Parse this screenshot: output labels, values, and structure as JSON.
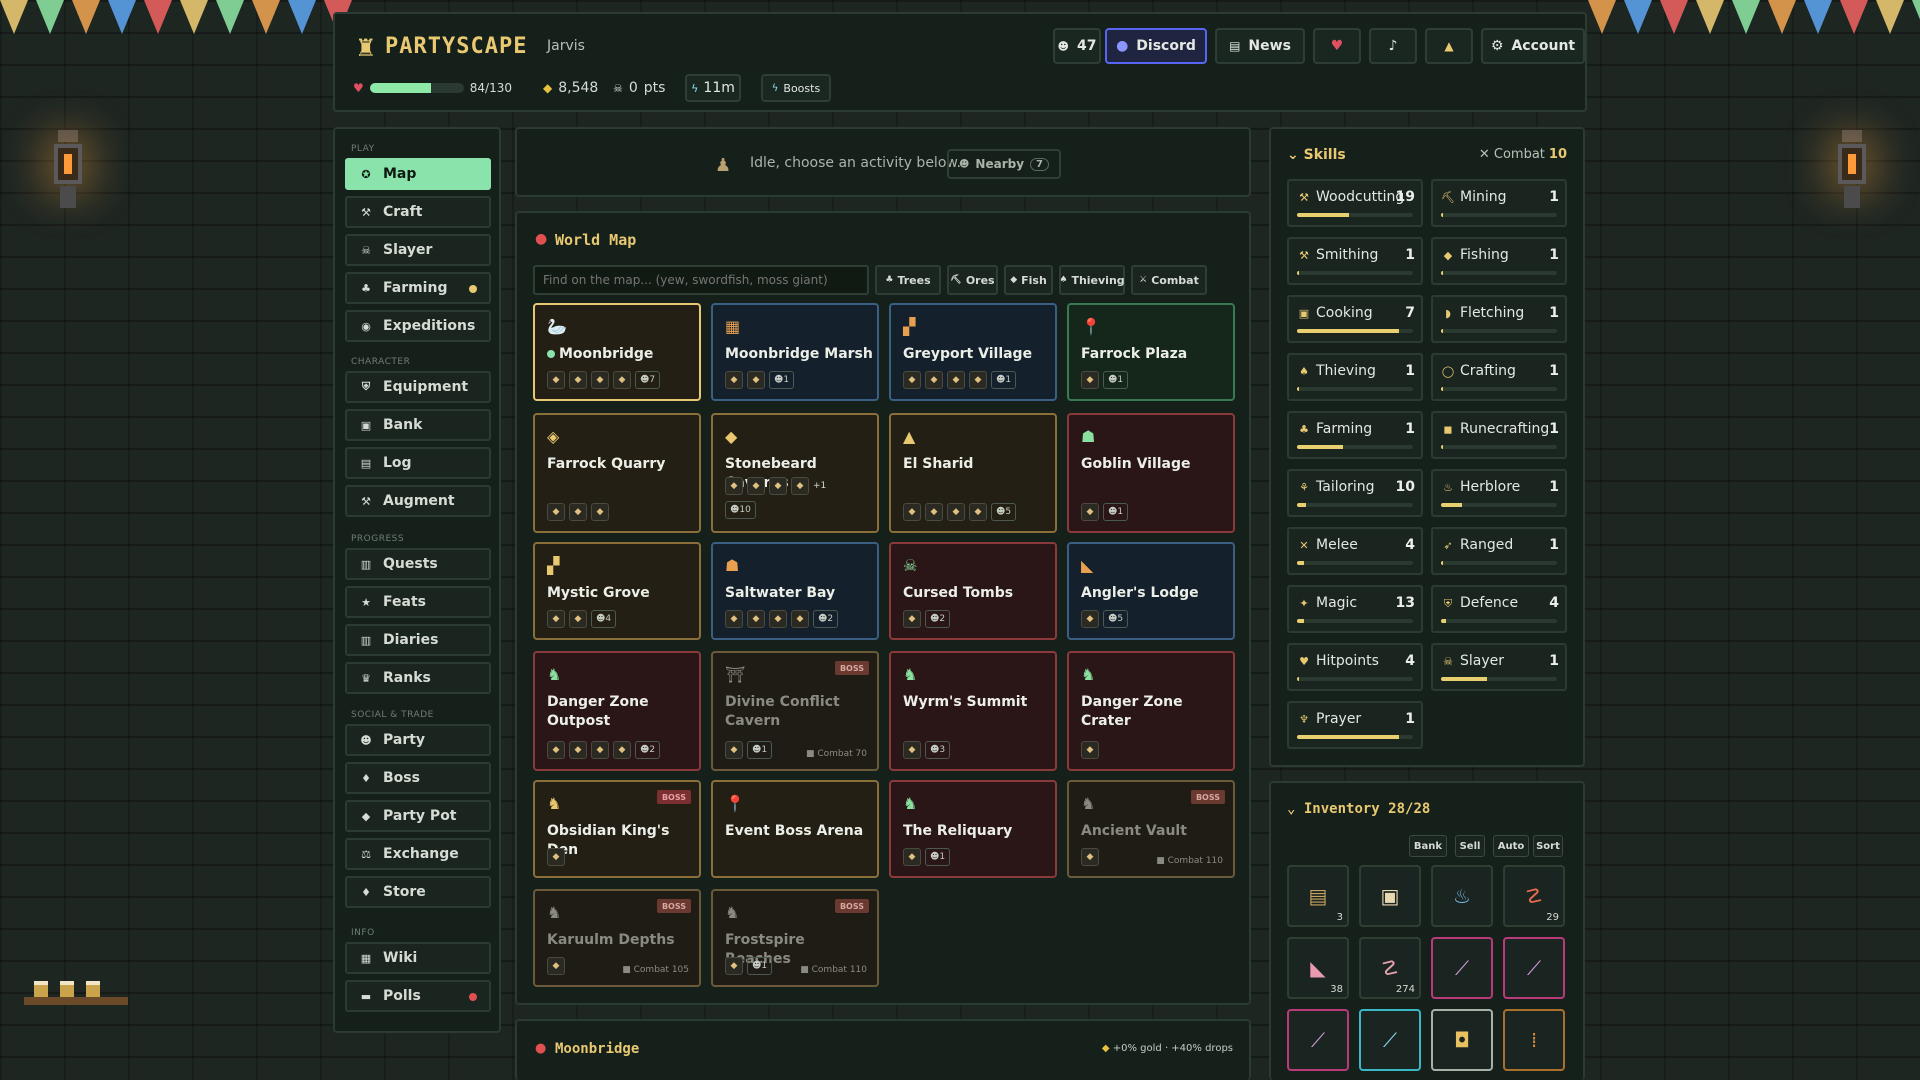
{
  "header": {
    "logo": "PARTYSCAPE",
    "username": "Jarvis",
    "online_count": "47",
    "buttons": {
      "discord": "Discord",
      "news": "News",
      "account": "Account"
    },
    "hp": {
      "value": 84,
      "max": 130,
      "text": "84/130"
    },
    "gold": "8,548",
    "points": "0",
    "points_label": "pts",
    "timer": "11m",
    "boosts": "Boosts"
  },
  "nav": {
    "sections": [
      "PLAY",
      "CHARACTER",
      "PROGRESS",
      "SOCIAL & TRADE",
      "INFO"
    ],
    "items": [
      {
        "label": "Map",
        "icon": "compass-icon",
        "glyph": "✪"
      },
      {
        "label": "Craft",
        "icon": "hammer-icon",
        "glyph": "⚒"
      },
      {
        "label": "Slayer",
        "icon": "skull-icon",
        "glyph": "☠"
      },
      {
        "label": "Farming",
        "icon": "sprout-icon",
        "glyph": "♣"
      },
      {
        "label": "Expeditions",
        "icon": "globe-icon",
        "glyph": "◉"
      },
      {
        "label": "Equipment",
        "icon": "shield-icon",
        "glyph": "⛨"
      },
      {
        "label": "Bank",
        "icon": "chest-icon",
        "glyph": "▣"
      },
      {
        "label": "Log",
        "icon": "book-icon",
        "glyph": "▤"
      },
      {
        "label": "Augment",
        "icon": "upgrade-icon",
        "glyph": "⚒"
      },
      {
        "label": "Quests",
        "icon": "scroll-icon",
        "glyph": "▥"
      },
      {
        "label": "Feats",
        "icon": "star-icon",
        "glyph": "★"
      },
      {
        "label": "Diaries",
        "icon": "diary-icon",
        "glyph": "▥"
      },
      {
        "label": "Ranks",
        "icon": "trophy-icon",
        "glyph": "♛"
      },
      {
        "label": "Party",
        "icon": "users-icon",
        "glyph": "☻"
      },
      {
        "label": "Boss",
        "icon": "boss-icon",
        "glyph": "♦"
      },
      {
        "label": "Party Pot",
        "icon": "pot-icon",
        "glyph": "◆"
      },
      {
        "label": "Exchange",
        "icon": "scales-icon",
        "glyph": "⚖"
      },
      {
        "label": "Store",
        "icon": "gem-icon",
        "glyph": "♦"
      },
      {
        "label": "Wiki",
        "icon": "wiki-book-icon",
        "glyph": "▦"
      },
      {
        "label": "Polls",
        "icon": "chat-icon",
        "glyph": "▬"
      }
    ]
  },
  "status": {
    "text": "Idle, choose an activity below.",
    "nearby_label": "Nearby",
    "nearby_count": "7"
  },
  "map": {
    "title": "World Map",
    "search_placeholder": "Find on the map... (yew, swordfish, moss giant)",
    "filters": [
      "Trees",
      "Ores",
      "Fish",
      "Thieving",
      "Combat"
    ],
    "boss_badge": "BOSS",
    "locations": [
      {
        "name": "Moonbridge",
        "color": "yellow",
        "icon": "🦢",
        "tags": 4,
        "players": "7",
        "selected": true
      },
      {
        "name": "Moonbridge Marsh",
        "color": "blue",
        "icon": "▦",
        "tags": 2,
        "players": "1"
      },
      {
        "name": "Greyport Village",
        "color": "blue",
        "icon": "▞",
        "tags": 4,
        "players": "1"
      },
      {
        "name": "Farrock Plaza",
        "color": "green",
        "icon": "📍",
        "tags": 1,
        "players": "1"
      },
      {
        "name": "Farrock Quarry",
        "color": "yellow",
        "icon": "◈",
        "tags": 3,
        "players": ""
      },
      {
        "name": "Stonebeard Caverns",
        "color": "yellow",
        "icon": "◆",
        "tags": 4,
        "extra": "+1",
        "players": "10"
      },
      {
        "name": "El Sharid",
        "color": "yellow",
        "icon": "▲",
        "tags": 4,
        "players": "5"
      },
      {
        "name": "Goblin Village",
        "color": "red",
        "icon": "☗",
        "tags": 1,
        "players": "1"
      },
      {
        "name": "Mystic Grove",
        "color": "yellow",
        "icon": "▞",
        "tags": 2,
        "players": "4"
      },
      {
        "name": "Saltwater Bay",
        "color": "blue",
        "icon": "☗",
        "tags": 4,
        "players": "2"
      },
      {
        "name": "Cursed Tombs",
        "color": "red",
        "icon": "☠",
        "tags": 1,
        "players": "2"
      },
      {
        "name": "Angler's Lodge",
        "color": "blue",
        "icon": "◣",
        "tags": 1,
        "players": "5"
      },
      {
        "name": "Danger Zone Outpost",
        "color": "red",
        "icon": "♞",
        "tags": 4,
        "players": "2"
      },
      {
        "name": "Divine Conflict Cavern",
        "color": "locked",
        "icon": "⛩",
        "tags": 1,
        "players": "1",
        "boss": true,
        "combat": "Combat 70"
      },
      {
        "name": "Wyrm's Summit",
        "color": "red",
        "icon": "♞",
        "tags": 1,
        "players": "3"
      },
      {
        "name": "Danger Zone Crater",
        "color": "red",
        "icon": "♞",
        "tags": 1,
        "players": ""
      },
      {
        "name": "Obsidian King's Den",
        "color": "yellow",
        "icon": "♞",
        "tags": 1,
        "players": "",
        "boss": true
      },
      {
        "name": "Event Boss Arena",
        "color": "yellow",
        "icon": "📍",
        "tags": 0,
        "players": ""
      },
      {
        "name": "The Reliquary",
        "color": "red",
        "icon": "♞",
        "tags": 1,
        "players": "1"
      },
      {
        "name": "Ancient Vault",
        "color": "locked",
        "icon": "♞",
        "tags": 1,
        "players": "",
        "boss": true,
        "combat": "Combat 110"
      },
      {
        "name": "Karuulm Depths",
        "color": "locked",
        "icon": "♞",
        "tags": 1,
        "players": "",
        "boss": true,
        "combat": "Combat 105"
      },
      {
        "name": "Frostspire Reaches",
        "color": "locked",
        "icon": "♞",
        "tags": 1,
        "players": "1",
        "boss": true,
        "combat": "Combat 110"
      }
    ]
  },
  "location": {
    "title": "Moonbridge",
    "bonus": "+0% gold · +40% drops"
  },
  "skills": {
    "title": "Skills",
    "combat_label": "Combat",
    "combat_level": "10",
    "list": [
      {
        "name": "Woodcutting",
        "level": "19",
        "progress": 0.45,
        "icon": "axe-icon",
        "glyph": "⚒"
      },
      {
        "name": "Mining",
        "level": "1",
        "progress": 0.02,
        "icon": "pickaxe-icon",
        "glyph": "⛏"
      },
      {
        "name": "Smithing",
        "level": "1",
        "progress": 0.02,
        "icon": "anvil-icon",
        "glyph": "⚒"
      },
      {
        "name": "Fishing",
        "level": "1",
        "progress": 0.02,
        "icon": "fish-icon",
        "glyph": "◆"
      },
      {
        "name": "Cooking",
        "level": "7",
        "progress": 0.88,
        "icon": "cooking-icon",
        "glyph": "▣"
      },
      {
        "name": "Fletching",
        "level": "1",
        "progress": 0.02,
        "icon": "bow-icon",
        "glyph": "◗"
      },
      {
        "name": "Thieving",
        "level": "1",
        "progress": 0.02,
        "icon": "thief-icon",
        "glyph": "♠"
      },
      {
        "name": "Crafting",
        "level": "1",
        "progress": 0.02,
        "icon": "ring-icon",
        "glyph": "◯"
      },
      {
        "name": "Farming",
        "level": "1",
        "progress": 0.4,
        "icon": "farming-icon",
        "glyph": "♣"
      },
      {
        "name": "Runecrafting",
        "level": "1",
        "progress": 0.02,
        "icon": "rune-icon",
        "glyph": "◼"
      },
      {
        "name": "Tailoring",
        "level": "10",
        "progress": 0.08,
        "icon": "needle-icon",
        "glyph": "⚘"
      },
      {
        "name": "Herblore",
        "level": "1",
        "progress": 0.18,
        "icon": "potion-icon",
        "glyph": "♨"
      },
      {
        "name": "Melee",
        "level": "4",
        "progress": 0.06,
        "icon": "swords-icon",
        "glyph": "✕"
      },
      {
        "name": "Ranged",
        "level": "1",
        "progress": 0.02,
        "icon": "arrow-icon",
        "glyph": "➶"
      },
      {
        "name": "Magic",
        "level": "13",
        "progress": 0.06,
        "icon": "wand-icon",
        "glyph": "✦"
      },
      {
        "name": "Defence",
        "level": "4",
        "progress": 0.04,
        "icon": "defence-shield-icon",
        "glyph": "⛨"
      },
      {
        "name": "Hitpoints",
        "level": "4",
        "progress": 0.02,
        "icon": "heart-icon",
        "glyph": "♥"
      },
      {
        "name": "Slayer",
        "level": "1",
        "progress": 0.4,
        "icon": "slayer-skull-icon",
        "glyph": "☠"
      },
      {
        "name": "Prayer",
        "level": "1",
        "progress": 0.88,
        "icon": "prayer-icon",
        "glyph": "♆"
      }
    ]
  },
  "inventory": {
    "title": "Inventory 28/28",
    "buttons": [
      "Bank",
      "Sell",
      "Auto",
      "Sort"
    ],
    "slots": [
      {
        "icon": "scroll-item-icon",
        "glyph": "▤",
        "qty": "3",
        "border": "",
        "color": "#c8a060"
      },
      {
        "icon": "food-item-icon",
        "glyph": "▣",
        "qty": "",
        "border": "",
        "color": "#e8d8b0"
      },
      {
        "icon": "potion-item-icon",
        "glyph": "♨",
        "qty": "",
        "border": "",
        "color": "#7ab8e8"
      },
      {
        "icon": "shrimp-item-icon",
        "glyph": "☡",
        "qty": "29",
        "border": "",
        "color": "#e86a50"
      },
      {
        "icon": "boot-item-icon",
        "glyph": "◣",
        "qty": "38",
        "border": "",
        "color": "#e89ab0"
      },
      {
        "icon": "shrimp-raw-item-icon",
        "glyph": "☡",
        "qty": "274",
        "border": "",
        "color": "#e8a0b0"
      },
      {
        "icon": "wand-item-icon",
        "glyph": "⟋",
        "qty": "",
        "border": "pink",
        "color": "#d8a0e0"
      },
      {
        "icon": "wand-item-icon",
        "glyph": "⟋",
        "qty": "",
        "border": "pink",
        "color": "#d8a0e0"
      },
      {
        "icon": "wand-item-icon",
        "glyph": "⟋",
        "qty": "",
        "border": "pink",
        "color": "#d8a0e0"
      },
      {
        "icon": "staff-item-icon",
        "glyph": "⟋",
        "qty": "",
        "border": "cyan",
        "color": "#8ae0f0"
      },
      {
        "icon": "helmet-item-icon",
        "glyph": "◘",
        "qty": "",
        "border": "light",
        "color": "#e8c060"
      },
      {
        "icon": "stick-item-icon",
        "glyph": "⁞",
        "qty": "",
        "border": "orange",
        "color": "#d88a3a"
      }
    ]
  },
  "colors": {
    "accent": "#e8c870",
    "active": "#8ae3aa",
    "discord": "#5865f2",
    "hp": "#8ee8a8"
  }
}
